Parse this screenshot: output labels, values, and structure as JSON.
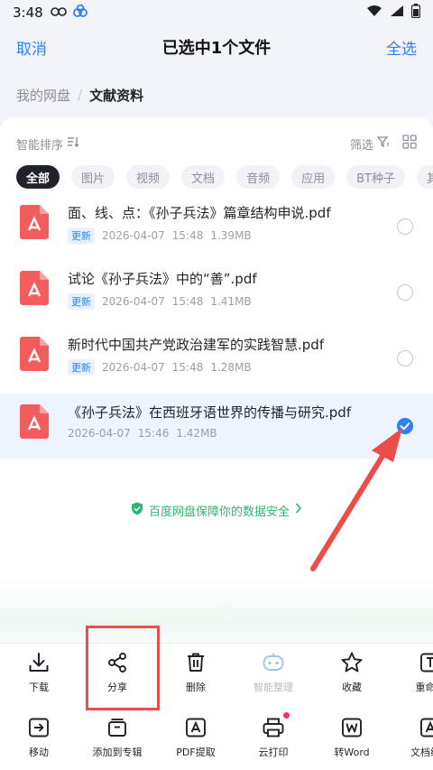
{
  "status_bar": {
    "time": "3:48"
  },
  "nav": {
    "cancel_label": "取消",
    "title": "已选中1个文件",
    "select_all_label": "全选"
  },
  "breadcrumb": {
    "root": "我的网盘",
    "separator": "/",
    "current": "文献资料"
  },
  "sort": {
    "label": "智能排序",
    "filter_label": "筛选"
  },
  "chips": [
    {
      "label": "全部",
      "active": true
    },
    {
      "label": "图片"
    },
    {
      "label": "视频"
    },
    {
      "label": "文档"
    },
    {
      "label": "音频"
    },
    {
      "label": "应用"
    },
    {
      "label": "BT种子"
    },
    {
      "label": "其他"
    }
  ],
  "files": [
    {
      "name": "面、线、点：《孙子兵法》篇章结构申说.pdf",
      "badge": "更新",
      "date": "2026-04-07",
      "time": "15:48",
      "size": "1.39MB",
      "selected": false
    },
    {
      "name": "试论《孙子兵法》中的“善”.pdf",
      "badge": "更新",
      "date": "2026-04-07",
      "time": "15:48",
      "size": "1.41MB",
      "selected": false
    },
    {
      "name": "新时代中国共产党政治建军的实践智慧.pdf",
      "badge": "更新",
      "date": "2026-04-07",
      "time": "15:48",
      "size": "1.28MB",
      "selected": false
    },
    {
      "name": "《孙子兵法》在西班牙语世界的传播与研究.pdf",
      "badge": "",
      "date": "2026-04-07",
      "time": "15:46",
      "size": "1.42MB",
      "selected": true
    }
  ],
  "security_notice": "百度网盘保障你的数据安全",
  "toolbar": {
    "row1": [
      {
        "label": "下载",
        "icon": "download-icon"
      },
      {
        "label": "分享",
        "icon": "share-icon"
      },
      {
        "label": "删除",
        "icon": "trash-icon"
      },
      {
        "label": "智能整理",
        "icon": "robot-icon",
        "disabled": true
      },
      {
        "label": "收藏",
        "icon": "star-icon"
      },
      {
        "label": "重命名",
        "icon": "rename-icon"
      }
    ],
    "row2": [
      {
        "label": "移动",
        "icon": "move-icon"
      },
      {
        "label": "添加到专辑",
        "icon": "album-icon"
      },
      {
        "label": "PDF提取",
        "icon": "pdf-extract-icon"
      },
      {
        "label": "云打印",
        "icon": "printer-icon"
      },
      {
        "label": "转Word",
        "icon": "word-icon"
      },
      {
        "label": "文档编辑",
        "icon": "doc-edit-icon"
      }
    ]
  },
  "colors": {
    "accent": "#2e80f5",
    "pdf_red": "#f25c5c",
    "security_green": "#2bb673",
    "annotation_red": "#ee4b4b"
  }
}
